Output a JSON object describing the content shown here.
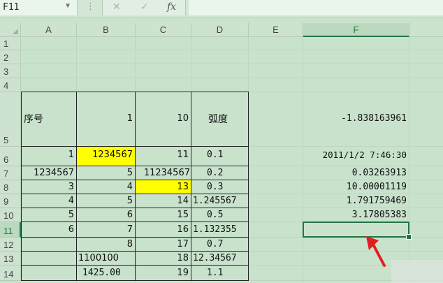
{
  "name_box": "F11",
  "formula_bar": {
    "cancel_icon": "✕",
    "enter_icon": "✓",
    "fx_label": "fx",
    "content": ""
  },
  "columns": [
    "A",
    "B",
    "C",
    "D",
    "E",
    "F"
  ],
  "selected_column": "F",
  "rows": [
    "1",
    "2",
    "3",
    "4",
    "5",
    "6",
    "7",
    "8",
    "9",
    "10",
    "11",
    "12",
    "13",
    "14"
  ],
  "selected_row": "11",
  "cells": {
    "A5": "序号",
    "B5": "1",
    "C5": "10",
    "D5": "弧度",
    "F5": "-1.838163961",
    "A6": "1",
    "B6": "1234567",
    "C6": "11",
    "D6": "0.1",
    "F6": "2011/1/2 7:46:30",
    "A7": "1234567",
    "B7": "5",
    "C7": "11234567",
    "D7": "0.2",
    "F7": "0.03263913",
    "A8": "3",
    "B8": "4",
    "C8": "13",
    "D8": "0.3",
    "F8": "10.00001119",
    "A9": "4",
    "B9": "5",
    "C9": "14",
    "D9": "1.245567",
    "F9": "1.791759469",
    "A10": "5",
    "B10": "6",
    "C10": "15",
    "D10": "0.5",
    "F10": "3.17805383",
    "A11": "6",
    "B11": "7",
    "C11": "16",
    "D11": "1.132355",
    "B12": "8",
    "C12": "17",
    "D12": "0.7",
    "B13": "1100100",
    "C13": "18",
    "D13": "12.34567",
    "B14": "1425.00",
    "C14": "19",
    "D14": "1.1"
  },
  "highlight_color": "#ffff00",
  "selection_color": "#217346"
}
